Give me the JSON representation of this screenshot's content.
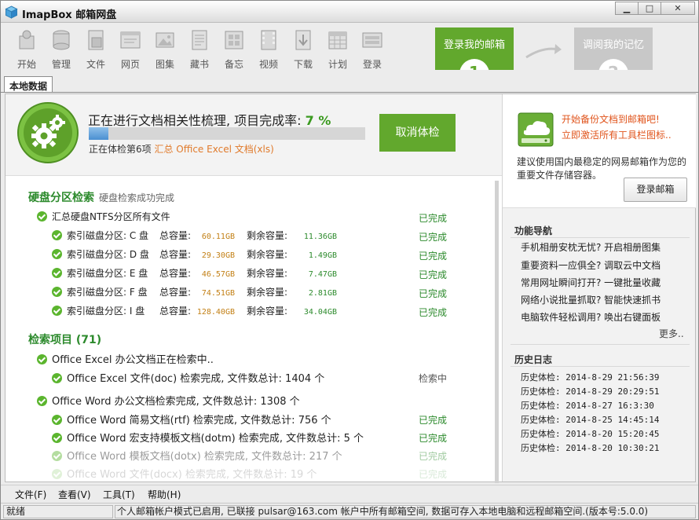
{
  "window": {
    "title": "ImapBox 邮箱网盘",
    "controls": [
      "minimize",
      "maximize",
      "close"
    ]
  },
  "toolbar": {
    "items": [
      {
        "label": "开始",
        "icon": "start-icon"
      },
      {
        "label": "管理",
        "icon": "database-icon"
      },
      {
        "label": "文件",
        "icon": "file-icon"
      },
      {
        "label": "网页",
        "icon": "web-icon"
      },
      {
        "label": "图集",
        "icon": "gallery-icon"
      },
      {
        "label": "藏书",
        "icon": "book-icon"
      },
      {
        "label": "备忘",
        "icon": "memo-icon"
      },
      {
        "label": "视频",
        "icon": "video-icon"
      },
      {
        "label": "下载",
        "icon": "download-icon"
      },
      {
        "label": "计划",
        "icon": "calendar-icon"
      },
      {
        "label": "登录",
        "icon": "login-icon"
      }
    ],
    "step1_label": "登录我的邮箱",
    "step1_num": "1",
    "step2_label": "调阅我的记忆",
    "step2_num": "2"
  },
  "tabs": [
    "本地数据"
  ],
  "progress": {
    "title": "正在进行文档相关性梳理, 项目完成率:",
    "percent_text": "7 %",
    "percent": 7,
    "sub_prefix": "正在体检第6项",
    "sub_highlight": "汇总 Office Excel 文档(xls)",
    "cancel_label": "取消体检"
  },
  "disk_section": {
    "title": "硬盘分区检索",
    "subtitle": "硬盘检索成功完成",
    "summary": {
      "label": "汇总硬盘NTFS分区所有文件",
      "status": "已完成"
    },
    "total_label": "总容量:",
    "free_label": "剩余容量:",
    "partitions": [
      {
        "label": "索引磁盘分区: C 盘",
        "total": "60.11GB",
        "free": "11.36GB",
        "status": "已完成"
      },
      {
        "label": "索引磁盘分区: D 盘",
        "total": "29.30GB",
        "free": "1.49GB",
        "status": "已完成"
      },
      {
        "label": "索引磁盘分区: E 盘",
        "total": "46.57GB",
        "free": "7.47GB",
        "status": "已完成"
      },
      {
        "label": "索引磁盘分区: F 盘",
        "total": "74.51GB",
        "free": "2.81GB",
        "status": "已完成"
      },
      {
        "label": "索引磁盘分区: I 盘",
        "total": "128.40GB",
        "free": "34.04GB",
        "status": "已完成"
      }
    ]
  },
  "search_section": {
    "title": "检索项目 (71)",
    "groups": [
      {
        "label": "Office Excel 办公文档正在检索中..",
        "items": [
          {
            "label": "Office Excel 文件(doc) 检索完成, 文件数总计: 1404 个",
            "status": "检索中"
          }
        ]
      },
      {
        "label": "Office Word 办公文档检索完成, 文件数总计: 1308 个",
        "items": [
          {
            "label": "Office Word 简易文档(rtf) 检索完成, 文件数总计: 756 个",
            "status": "已完成"
          },
          {
            "label": "Office Word 宏支持模板文档(dotm) 检索完成, 文件数总计: 5 个",
            "status": "已完成"
          },
          {
            "label": "Office Word 模板文档(dotx) 检索完成, 文件数总计: 217 个",
            "status": "已完成"
          },
          {
            "label": "Office Word 文件(docx) 检索完成, 文件数总计: 19 个",
            "status": "已完成"
          }
        ]
      }
    ]
  },
  "promo": {
    "line1": "开始备份文档到邮箱吧!",
    "line2": "立即激活所有工具栏图标..",
    "desc": "建议使用国内最稳定的网易邮箱作为您的重要文件存储容器。",
    "login_label": "登录邮箱"
  },
  "nav": {
    "title": "功能导航",
    "items": [
      "手机相册安枕无忧? 开启相册图集",
      "重要资料一应俱全? 调取云中文档",
      "常用网址瞬间打开? 一键批量收藏",
      "网络小说批量抓取? 智能快速抓书",
      "电脑软件轻松调用? 唤出右键面板"
    ],
    "more": "更多.."
  },
  "history": {
    "title": "历史日志",
    "items": [
      "历史体检: 2014-8-29 21:56:39",
      "历史体检: 2014-8-29 20:29:51",
      "历史体检: 2014-8-27 16:3:30",
      "历史体检: 2014-8-25 14:45:14",
      "历史体检: 2014-8-20 15:20:45",
      "历史体检: 2014-8-20 10:30:21"
    ]
  },
  "menu": [
    "文件(F)",
    "查看(V)",
    "工具(T)",
    "帮助(H)"
  ],
  "statusbar": {
    "left": "就绪",
    "right": "个人邮箱帐户模式已启用, 已联接 pulsar@163.com 帐户中所有邮箱空间, 数据可存入本地电脑和远程邮箱空间.(版本号:5.0.0)"
  },
  "colors": {
    "accent_green": "#62a82d",
    "status_green": "#2c8a2c",
    "highlight_orange": "#e07a2b",
    "promo_red": "#e0541c"
  }
}
